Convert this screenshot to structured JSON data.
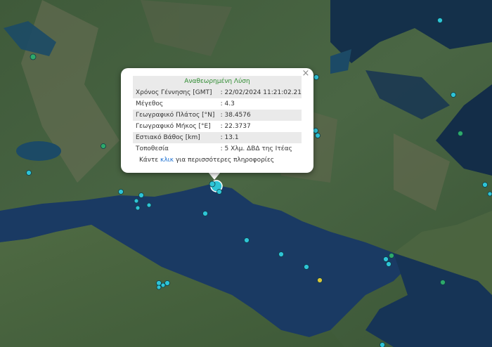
{
  "popup": {
    "title": "Αναθεωρημένη Λύση",
    "close_label": "×",
    "rows": [
      {
        "key": "Χρόνος Γέννησης [GMT]",
        "value": ": 22/02/2024 11:21:02.21"
      },
      {
        "key": "Μέγεθος",
        "value": ": 4.3"
      },
      {
        "key": "Γεωγραφικό Πλάτος [°N]",
        "value": ": 38.4576"
      },
      {
        "key": "Γεωγραφικό Μήκος [°E]",
        "value": ": 22.3737"
      },
      {
        "key": "Εστιακό Βάθος [km]",
        "value": ": 13.1"
      },
      {
        "key": "Τοποθεσία",
        "value": ": 5 Χλμ. ΔΒΔ της Ιτέας"
      }
    ],
    "footer_before": "Κάντε ",
    "footer_link": "κλικ",
    "footer_after": " για περισσότερες πληροφορίες"
  },
  "colors": {
    "marker_cyan": "#2ec4d6",
    "marker_green": "#2ea96a",
    "marker_yellow": "#d9c43a",
    "title_green": "#2e8b30",
    "link_blue": "#1a6fd1"
  }
}
